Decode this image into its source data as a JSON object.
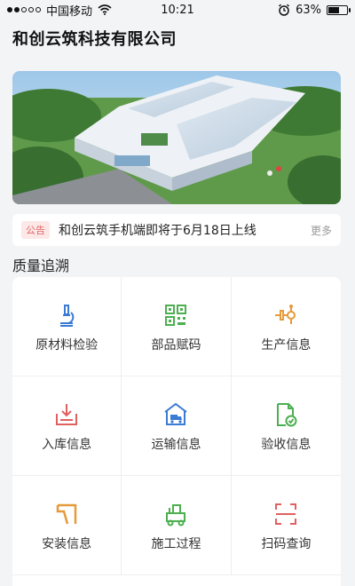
{
  "status_bar": {
    "carrier": "中国移动",
    "time": "10:21",
    "battery": "63%",
    "battery_level": 0.63
  },
  "header": {
    "title": "和创云筑科技有限公司"
  },
  "notice": {
    "tag": "公告",
    "text": "和创云筑手机端即将于6月18日上线",
    "more": "更多"
  },
  "section": {
    "title": "质量追溯"
  },
  "grid": [
    {
      "label": "原材料检验",
      "icon": "microscope-icon",
      "color": "#3a7bd5"
    },
    {
      "label": "部品赋码",
      "icon": "qr-code-icon",
      "color": "#4caf50"
    },
    {
      "label": "生产信息",
      "icon": "production-icon",
      "color": "#e69a3a"
    },
    {
      "label": "入库信息",
      "icon": "inbound-icon",
      "color": "#e06060"
    },
    {
      "label": "运输信息",
      "icon": "transport-icon",
      "color": "#3a7bd5"
    },
    {
      "label": "验收信息",
      "icon": "acceptance-icon",
      "color": "#4caf50"
    },
    {
      "label": "安装信息",
      "icon": "install-icon",
      "color": "#e69a3a"
    },
    {
      "label": "施工过程",
      "icon": "construction-icon",
      "color": "#4caf50"
    },
    {
      "label": "扫码查询",
      "icon": "scan-icon",
      "color": "#e06060"
    }
  ]
}
